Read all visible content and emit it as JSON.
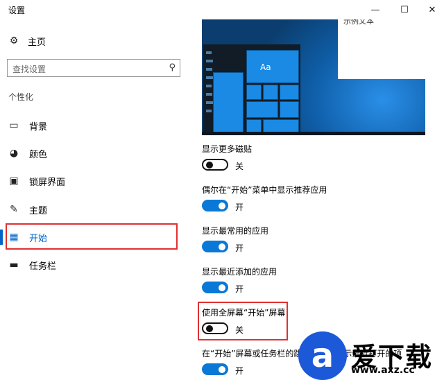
{
  "window": {
    "title": "设置",
    "min_icon": "minimize-icon",
    "max_icon": "maximize-icon",
    "close_icon": "close-icon"
  },
  "sidebar": {
    "home": {
      "label": "主页",
      "icon": "gear-icon"
    },
    "search": {
      "placeholder": "查找设置",
      "icon": "search-icon"
    },
    "section": "个性化",
    "items": [
      {
        "label": "背景",
        "icon": "picture-icon"
      },
      {
        "label": "颜色",
        "icon": "palette-icon"
      },
      {
        "label": "锁屏界面",
        "icon": "lockscreen-icon"
      },
      {
        "label": "主题",
        "icon": "theme-brush-icon"
      },
      {
        "label": "开始",
        "icon": "start-grid-icon",
        "selected": true
      },
      {
        "label": "任务栏",
        "icon": "taskbar-icon"
      }
    ]
  },
  "preview": {
    "sample_text": "示例文本",
    "tile_text": "Aa"
  },
  "settings": [
    {
      "label": "显示更多磁贴",
      "state": "关",
      "on": false
    },
    {
      "label": "偶尔在“开始”菜单中显示推荐应用",
      "state": "开",
      "on": true
    },
    {
      "label": "显示最常用的应用",
      "state": "开",
      "on": true
    },
    {
      "label": "显示最近添加的应用",
      "state": "开",
      "on": true
    },
    {
      "label": "使用全屏幕“开始”屏幕",
      "state": "关",
      "on": false
    },
    {
      "label": "在“开始”屏幕或任务栏的跳转列表中显示最近打开的项",
      "state": "开",
      "on": true
    }
  ],
  "watermark": {
    "logo": "a",
    "title": "爱下载",
    "url": "www.axz.cc"
  },
  "colors": {
    "accent": "#0a78d7",
    "highlight_box": "#e03030",
    "selected_text": "#0064c8"
  }
}
